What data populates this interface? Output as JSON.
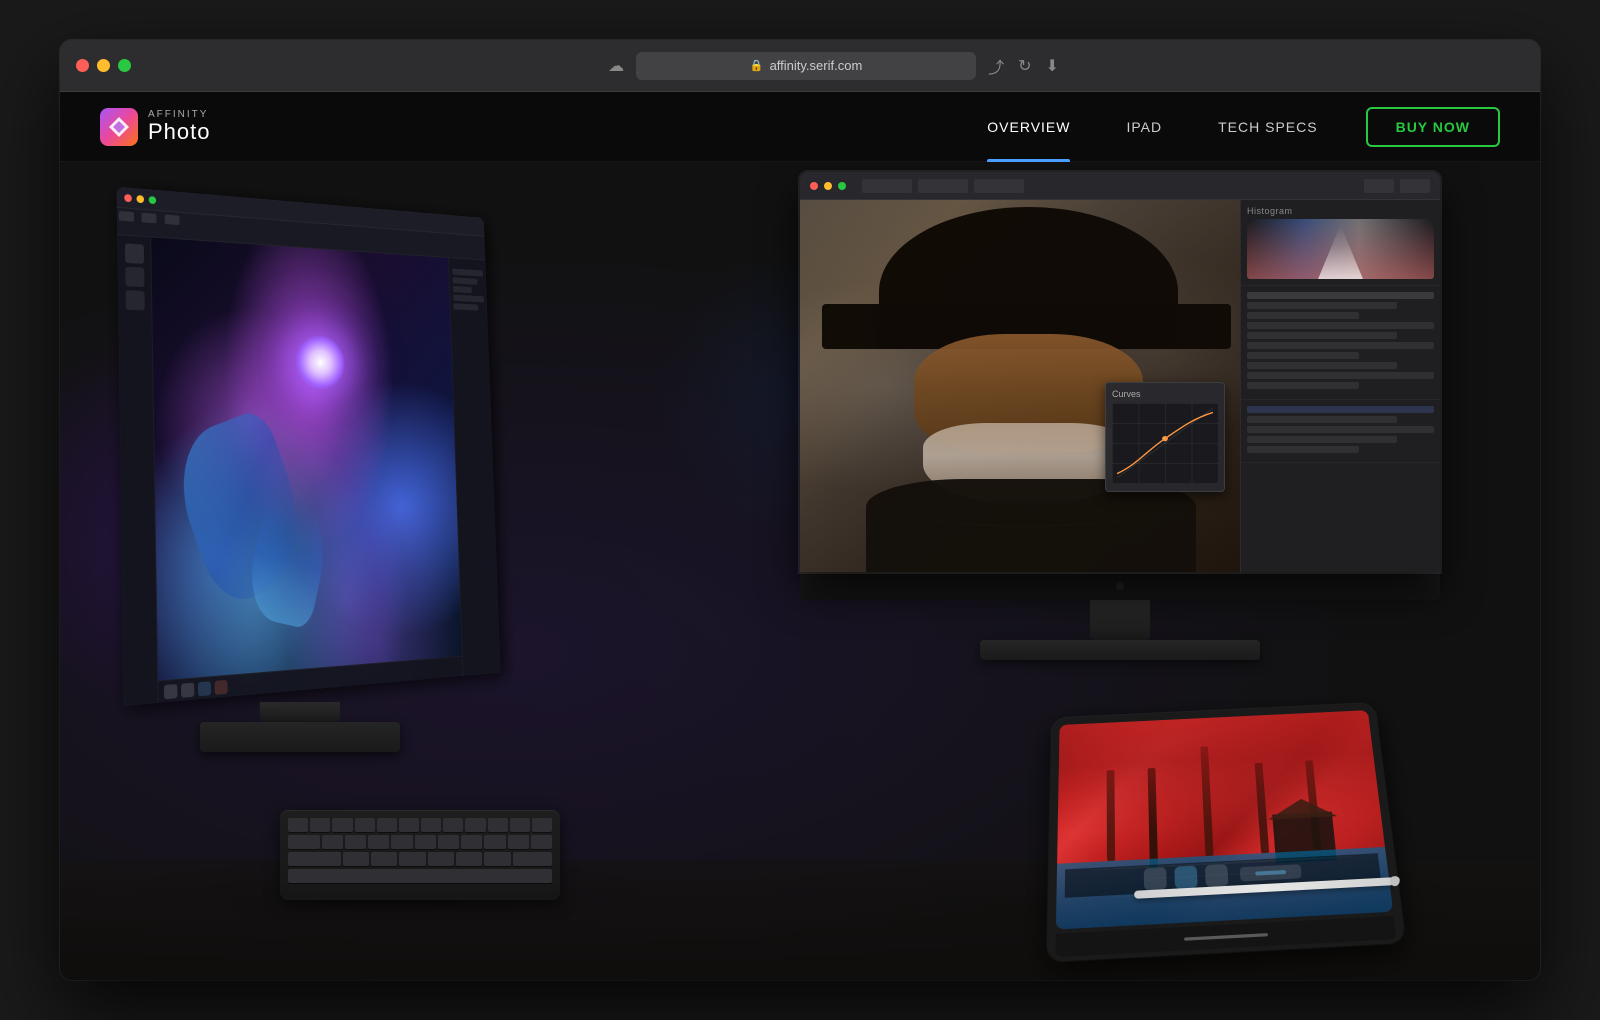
{
  "browser": {
    "url": "affinity.serif.com",
    "tab_icon": "🔒"
  },
  "navbar": {
    "logo": {
      "icon_letter": "✦",
      "brand_name": "AFFINITY",
      "product_name": "Photo"
    },
    "links": [
      {
        "label": "OVERVIEW",
        "active": true,
        "id": "overview"
      },
      {
        "label": "IPAD",
        "active": false,
        "id": "ipad"
      },
      {
        "label": "TECH SPECS",
        "active": false,
        "id": "tech-specs"
      }
    ],
    "cta": {
      "label": "BUY NOW"
    }
  },
  "hero": {
    "devices": {
      "left_monitor": {
        "type": "desktop_monitor",
        "content": "digital_art_colorful"
      },
      "right_monitor": {
        "type": "imac_display",
        "content": "portrait_photo"
      },
      "ipad": {
        "type": "tablet",
        "content": "forest_photo_red"
      }
    }
  }
}
